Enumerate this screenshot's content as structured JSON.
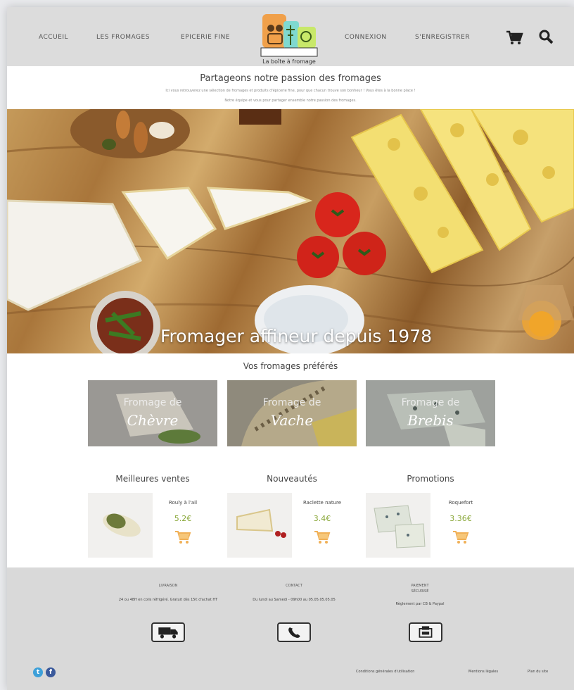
{
  "nav": {
    "items": [
      "ACCUEIL",
      "LES FROMAGES",
      "EPICERIE FINE",
      "CONNEXION",
      "S'ENREGISTRER"
    ]
  },
  "logo": {
    "text": "La boîte à fromage"
  },
  "icons": {
    "cart": "cart-icon",
    "search": "search-icon"
  },
  "tagline": {
    "title": "Partageons notre passion des fromages",
    "sub1": "Ici vous retrouverez une sélection de fromages et produits d'épicerie fine, pour que chacun trouve son bonheur ! Vous êtes à la bonne place !",
    "sub2": "Notre équipe et vous pour partager ensemble notre passion des fromages."
  },
  "hero": {
    "caption": "Fromager affineur depuis 1978"
  },
  "favorites": {
    "title": "Vos fromages préférés",
    "items": [
      {
        "line1": "Fromage de",
        "line2": "Chèvre"
      },
      {
        "line1": "Fromage de",
        "line2": "Vache"
      },
      {
        "line1": "Fromage de",
        "line2": "Brebis"
      }
    ]
  },
  "columns": [
    {
      "title": "Meilleures ventes",
      "product": "Rouly à l'ail",
      "price": "5.2€"
    },
    {
      "title": "Nouveautés",
      "product": "Raclette nature",
      "price": "3.4€"
    },
    {
      "title": "Promotions",
      "product": "Roquefort",
      "price": "3.36€"
    }
  ],
  "footer": {
    "livraison": {
      "head": "LIVRAISON",
      "text": "24 ou 48H en colis réfrigéré. Gratuit dès 15€ d'achat HT"
    },
    "contact": {
      "head": "CONTACT",
      "text": "Du lundi au Samedi - 09h00 au 05.05.05.05.05"
    },
    "paiement": {
      "head1": "PAIEMENT",
      "head2": "SÉCURISÉ",
      "text": "Règlement par CB & Paypal"
    },
    "links": [
      "Conditions générales d'utilisation",
      "Mentions légales",
      "Plan du site"
    ]
  },
  "colors": {
    "accent": "#8aa83a",
    "header_bg": "#dcdcdc",
    "footer_bg": "#d9d9d9"
  }
}
